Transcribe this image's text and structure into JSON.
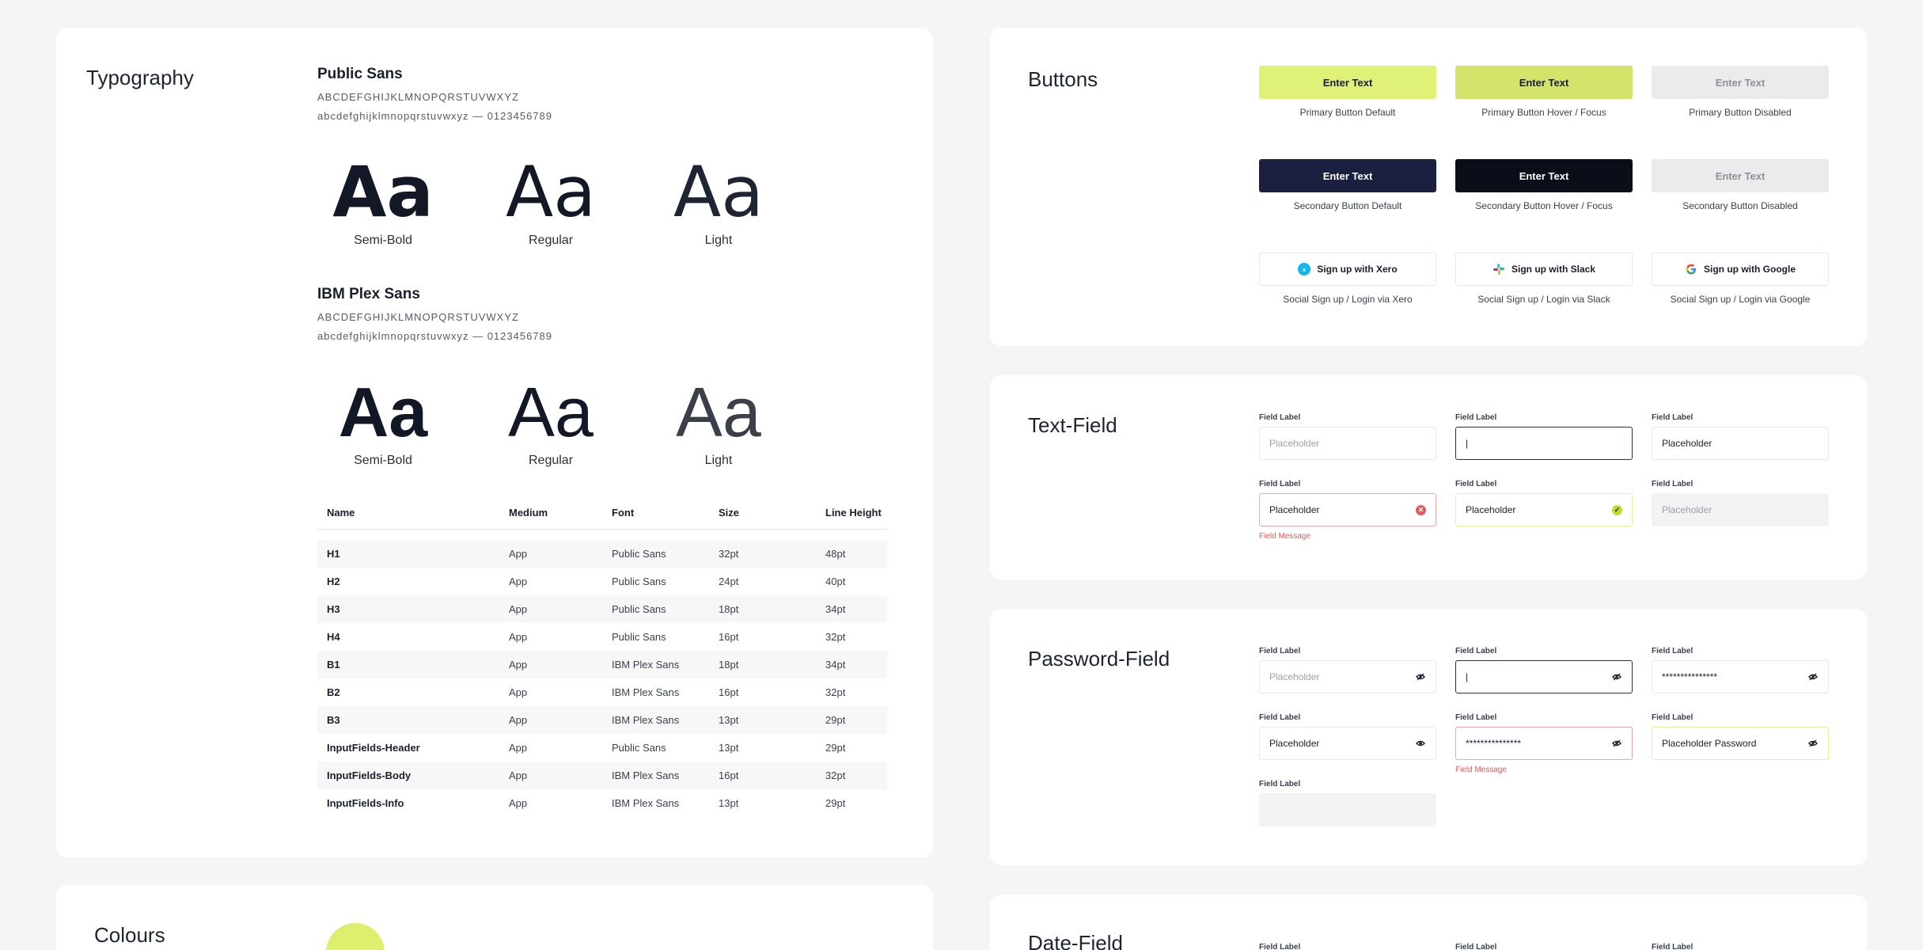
{
  "typography": {
    "title": "Typography",
    "fonts": [
      {
        "name": "Public Sans",
        "upper": "ABCDEFGHIJKLMNOPQRSTUVWXYZ",
        "lower": "abcdefghijklmnopqrstuvwxyz — 0123456789",
        "samples": [
          {
            "glyph": "Aa",
            "label": "Semi-Bold"
          },
          {
            "glyph": "Aa",
            "label": "Regular"
          },
          {
            "glyph": "Aa",
            "label": "Light"
          }
        ]
      },
      {
        "name": "IBM Plex Sans",
        "upper": "ABCDEFGHIJKLMNOPQRSTUVWXYZ",
        "lower": "abcdefghijklmnopqrstuvwxyz — 0123456789",
        "samples": [
          {
            "glyph": "Aa",
            "label": "Semi-Bold"
          },
          {
            "glyph": "Aa",
            "label": "Regular"
          },
          {
            "glyph": "Aa",
            "label": "Light"
          }
        ]
      }
    ],
    "table": {
      "headers": [
        "Name",
        "Medium",
        "Font",
        "Size",
        "Line Height"
      ],
      "rows": [
        [
          "H1",
          "App",
          "Public Sans",
          "32pt",
          "48pt"
        ],
        [
          "H2",
          "App",
          "Public Sans",
          "24pt",
          "40pt"
        ],
        [
          "H3",
          "App",
          "Public Sans",
          "18pt",
          "34pt"
        ],
        [
          "H4",
          "App",
          "Public Sans",
          "16pt",
          "32pt"
        ],
        [
          "B1",
          "App",
          "IBM Plex Sans",
          "18pt",
          "34pt"
        ],
        [
          "B2",
          "App",
          "IBM Plex Sans",
          "16pt",
          "32pt"
        ],
        [
          "B3",
          "App",
          "IBM Plex Sans",
          "13pt",
          "29pt"
        ],
        [
          "InputFields-Header",
          "App",
          "Public Sans",
          "13pt",
          "29pt"
        ],
        [
          "InputFields-Body",
          "App",
          "IBM Plex Sans",
          "16pt",
          "32pt"
        ],
        [
          "InputFields-Info",
          "App",
          "IBM Plex Sans",
          "13pt",
          "29pt"
        ]
      ]
    }
  },
  "colours": {
    "title": "Colours",
    "swatch": "#dfee6c"
  },
  "buttons": {
    "title": "Buttons",
    "items": [
      {
        "label": "Enter Text",
        "caption": "Primary Button Default",
        "bg": "#dff176",
        "fg": "#1a1f2e"
      },
      {
        "label": "Enter Text",
        "caption": "Primary Button Hover / Focus",
        "bg": "#d4e46a",
        "fg": "#1a1f2e"
      },
      {
        "label": "Enter Text",
        "caption": "Primary Button Disabled",
        "bg": "#ebebeb",
        "fg": "#8c9099"
      },
      {
        "label": "Enter Text",
        "caption": "Secondary Button Default",
        "bg": "#1b2040",
        "fg": "#ffffff"
      },
      {
        "label": "Enter Text",
        "caption": "Secondary Button Hover / Focus",
        "bg": "#0b0e18",
        "fg": "#ffffff"
      },
      {
        "label": "Enter Text",
        "caption": "Secondary Button Disabled",
        "bg": "#ebebeb",
        "fg": "#8c9099"
      }
    ],
    "social": [
      {
        "label": "Sign up with Xero",
        "caption": "Social Sign up / Login via Xero",
        "icon": "xero-icon"
      },
      {
        "label": "Sign up with Slack",
        "caption": "Social Sign up / Login via Slack",
        "icon": "slack-icon"
      },
      {
        "label": "Sign up with Google",
        "caption": "Social Sign up / Login via Google",
        "icon": "google-icon"
      }
    ]
  },
  "textfield": {
    "title": "Text-Field",
    "label": "Field Label",
    "placeholder": "Placeholder",
    "cursor": "|",
    "message": "Field Message"
  },
  "password": {
    "title": "Password-Field",
    "label": "Field Label",
    "placeholder": "Placeholder",
    "cursor": "|",
    "masked": "***************",
    "placeholder_password": "Placeholder Password",
    "message": "Field Message"
  },
  "datefield": {
    "title": "Date-Field",
    "label": "Field Label"
  }
}
